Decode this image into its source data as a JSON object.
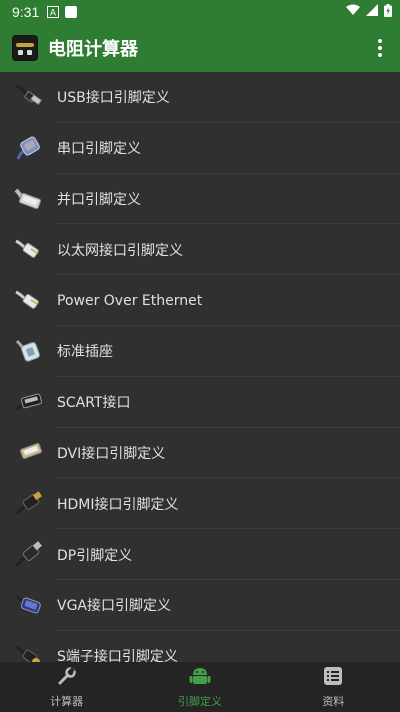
{
  "status_bar": {
    "time": "9:31"
  },
  "app_bar": {
    "title": "电阻计算器"
  },
  "list": {
    "items": [
      {
        "label": "USB接口引脚定义",
        "icon": "usb-cable-icon"
      },
      {
        "label": "串口引脚定义",
        "icon": "serial-port-icon"
      },
      {
        "label": "并口引脚定义",
        "icon": "parallel-port-icon"
      },
      {
        "label": "以太网接口引脚定义",
        "icon": "ethernet-cable-icon"
      },
      {
        "label": "Power Over Ethernet",
        "icon": "poe-cable-icon"
      },
      {
        "label": "标准插座",
        "icon": "socket-icon"
      },
      {
        "label": "SCART接口",
        "icon": "scart-cable-icon"
      },
      {
        "label": "DVI接口引脚定义",
        "icon": "dvi-cable-icon"
      },
      {
        "label": "HDMI接口引脚定义",
        "icon": "hdmi-cable-icon"
      },
      {
        "label": "DP引脚定义",
        "icon": "displayport-cable-icon"
      },
      {
        "label": "VGA接口引脚定义",
        "icon": "vga-cable-icon"
      },
      {
        "label": "S端子接口引脚定义",
        "icon": "svideo-cable-icon"
      }
    ]
  },
  "bottom_nav": {
    "items": [
      {
        "label": "计算器",
        "icon": "wrench-icon"
      },
      {
        "label": "引脚定义",
        "icon": "android-icon"
      },
      {
        "label": "资料",
        "icon": "list-icon"
      }
    ],
    "active": "引脚定义"
  },
  "colors": {
    "primary": "#2e7d32",
    "accent": "#43a047",
    "background": "#303030"
  }
}
